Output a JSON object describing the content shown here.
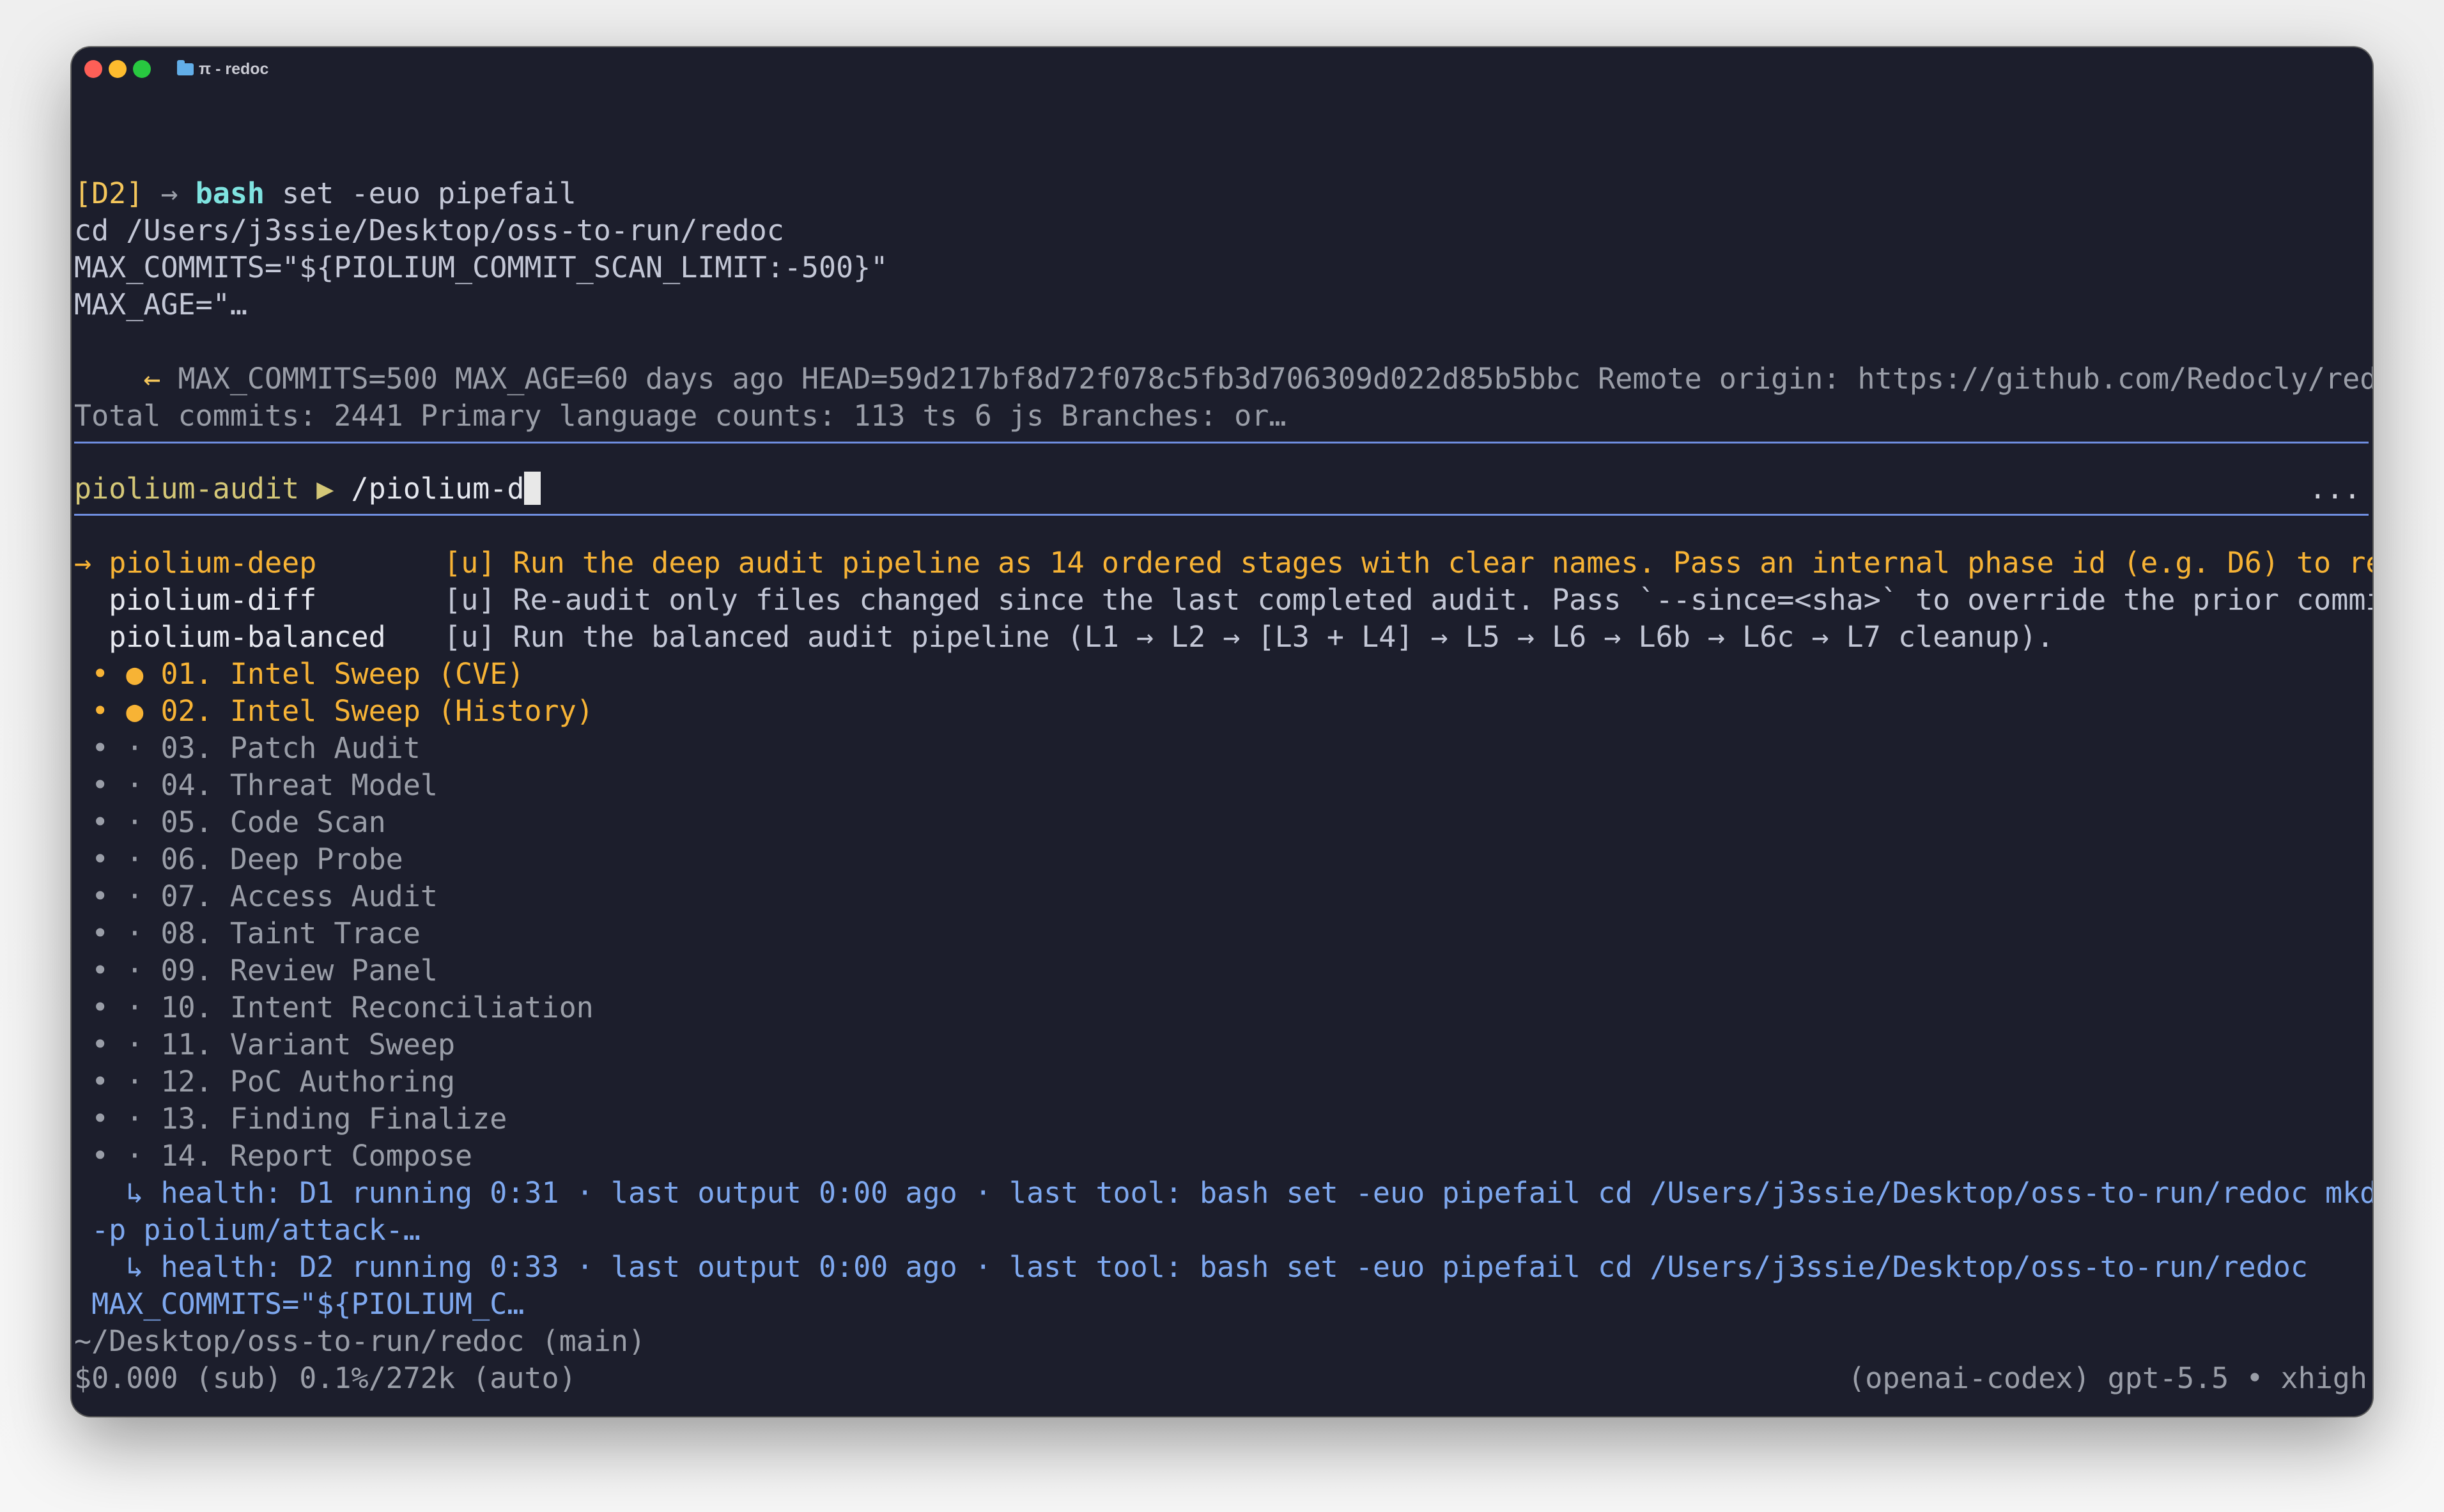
{
  "window": {
    "title": "π - redoc"
  },
  "colors": {
    "accent_yellow": "#f4c65b",
    "running_orange": "#f7b335",
    "health_blue": "#7ea8ef",
    "rule_blue": "#6f8ee0",
    "background": "#1c1e2c"
  },
  "history": {
    "tag": "[D2]",
    "arrow": "→",
    "tool": "bash",
    "cmd_rest": " set -euo pipefail",
    "lines": [
      "cd /Users/j3ssie/Desktop/oss-to-run/redoc",
      "MAX_COMMITS=\"${PIOLIUM_COMMIT_SCAN_LIMIT:-500}\"",
      "MAX_AGE=\"…"
    ],
    "output_arrow": "←",
    "output_line1": " MAX_COMMITS=500 MAX_AGE=60 days ago HEAD=59d217bf8d72f078c5fb3d706309d022d85b5bbc Remote origin: https://github.com/Redocly/redoc",
    "output_line2": "Total commits: 2441 Primary language counts: 113 ts 6 js Branches: or…"
  },
  "prompt": {
    "name": "piolium-audit",
    "separator": "▶",
    "input": "/piolium-d",
    "more": "..."
  },
  "suggestions": [
    {
      "marker": "→",
      "command": "piolium-deep",
      "description": "[u] Run the deep audit pipeline as 14 ordered stages with clear names. Pass an internal phase id (e.g. D6) to rerun"
    },
    {
      "marker": " ",
      "command": "piolium-diff",
      "description": "[u] Re-audit only files changed since the last completed audit. Pass `--since=<sha>` to override the prior commit."
    },
    {
      "marker": " ",
      "command": "piolium-balanced",
      "description": "[u] Run the balanced audit pipeline (L1 → L2 → [L3 + L4] → L5 → L6 → L6b → L6c → L7 cleanup)."
    }
  ],
  "stages": [
    {
      "text": " • ● 01. Intel Sweep (CVE)",
      "state": "running"
    },
    {
      "text": " • ● 02. Intel Sweep (History)",
      "state": "running"
    },
    {
      "text": " • · 03. Patch Audit",
      "state": "pending"
    },
    {
      "text": " • · 04. Threat Model",
      "state": "pending"
    },
    {
      "text": " • · 05. Code Scan",
      "state": "pending"
    },
    {
      "text": " • · 06. Deep Probe",
      "state": "pending"
    },
    {
      "text": " • · 07. Access Audit",
      "state": "pending"
    },
    {
      "text": " • · 08. Taint Trace",
      "state": "pending"
    },
    {
      "text": " • · 09. Review Panel",
      "state": "pending"
    },
    {
      "text": " • · 10. Intent Reconciliation",
      "state": "pending"
    },
    {
      "text": " • · 11. Variant Sweep",
      "state": "pending"
    },
    {
      "text": " • · 12. PoC Authoring",
      "state": "pending"
    },
    {
      "text": " • · 13. Finding Finalize",
      "state": "pending"
    },
    {
      "text": " • · 14. Report Compose",
      "state": "pending"
    }
  ],
  "health": [
    "   ↳ health: D1 running 0:31 · last output 0:00 ago · last tool: bash set -euo pipefail cd /Users/j3ssie/Desktop/oss-to-run/redoc mkdir",
    " -p piolium/attack-…",
    "   ↳ health: D2 running 0:33 · last output 0:00 ago · last tool: bash set -euo pipefail cd /Users/j3ssie/Desktop/oss-to-run/redoc",
    " MAX_COMMITS=\"${PIOLIUM_C…"
  ],
  "footer": {
    "cwd": "~/Desktop/oss-to-run/redoc (main)",
    "cost": "$0.000 (sub) 0.1%/272k (auto)",
    "model": "(openai-codex) gpt-5.5 • xhigh"
  }
}
